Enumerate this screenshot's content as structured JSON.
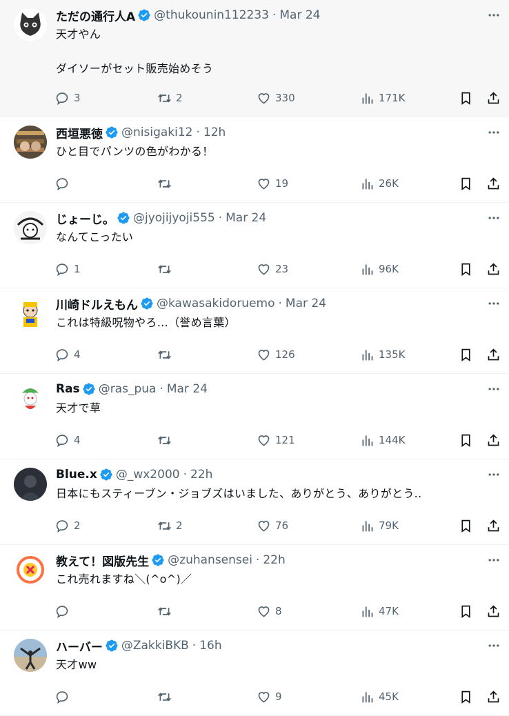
{
  "tweets": [
    {
      "name": "ただの通行人A",
      "handle": "@thukounin112233",
      "time": "Mar 24",
      "lines": [
        "天才やん",
        "ダイソーがセット販売始めそう"
      ],
      "replies": "3",
      "retweets": "2",
      "likes": "330",
      "views": "171K",
      "avatar": "cat-avatar"
    },
    {
      "name": "西垣悪徳",
      "handle": "@nisigaki12",
      "time": "12h",
      "lines": [
        "ひと目でパンツの色がわかる！"
      ],
      "replies": "",
      "retweets": "",
      "likes": "19",
      "views": "26K",
      "avatar": "shelf-avatar"
    },
    {
      "name": "じょーじ。",
      "handle": "@jyojijyoji555",
      "time": "Mar 24",
      "lines": [
        "なんてこったい"
      ],
      "replies": "1",
      "retweets": "",
      "likes": "23",
      "views": "96K",
      "avatar": "manga-avatar"
    },
    {
      "name": "川崎ドルえもん",
      "handle": "@kawasakidoruemo",
      "time": "Mar 24",
      "lines": [
        "これは特級呪物やろ…（誉め言葉）"
      ],
      "replies": "4",
      "retweets": "",
      "likes": "126",
      "views": "135K",
      "avatar": "mascot-avatar"
    },
    {
      "name": "Ras",
      "handle": "@ras_pua",
      "time": "Mar 24",
      "lines": [
        "天才で草"
      ],
      "replies": "4",
      "retweets": "",
      "likes": "121",
      "views": "144K",
      "avatar": "character-avatar"
    },
    {
      "name": "Blue.x",
      "handle": "@_wx2000",
      "time": "22h",
      "lines": [
        "日本にもスティーブン・ジョブズはいました、ありがとう、ありがとう.."
      ],
      "replies": "2",
      "retweets": "2",
      "likes": "76",
      "views": "79K",
      "avatar": "dark-photo-avatar"
    },
    {
      "name": "教えて！図版先生",
      "handle": "@zuhansensei",
      "time": "22h",
      "lines": [
        "これ売れますね＼(^o^)／"
      ],
      "replies": "",
      "retweets": "",
      "likes": "8",
      "views": "47K",
      "avatar": "logo-avatar"
    },
    {
      "name": "ハーバー",
      "handle": "@ZakkiBKB",
      "time": "16h",
      "lines": [
        "天才ww"
      ],
      "replies": "",
      "retweets": "",
      "likes": "9",
      "views": "45K",
      "avatar": "beach-photo-avatar"
    }
  ],
  "colors": {
    "verified": "#1d9bf0",
    "muted": "#536471",
    "text": "#0f1419"
  }
}
